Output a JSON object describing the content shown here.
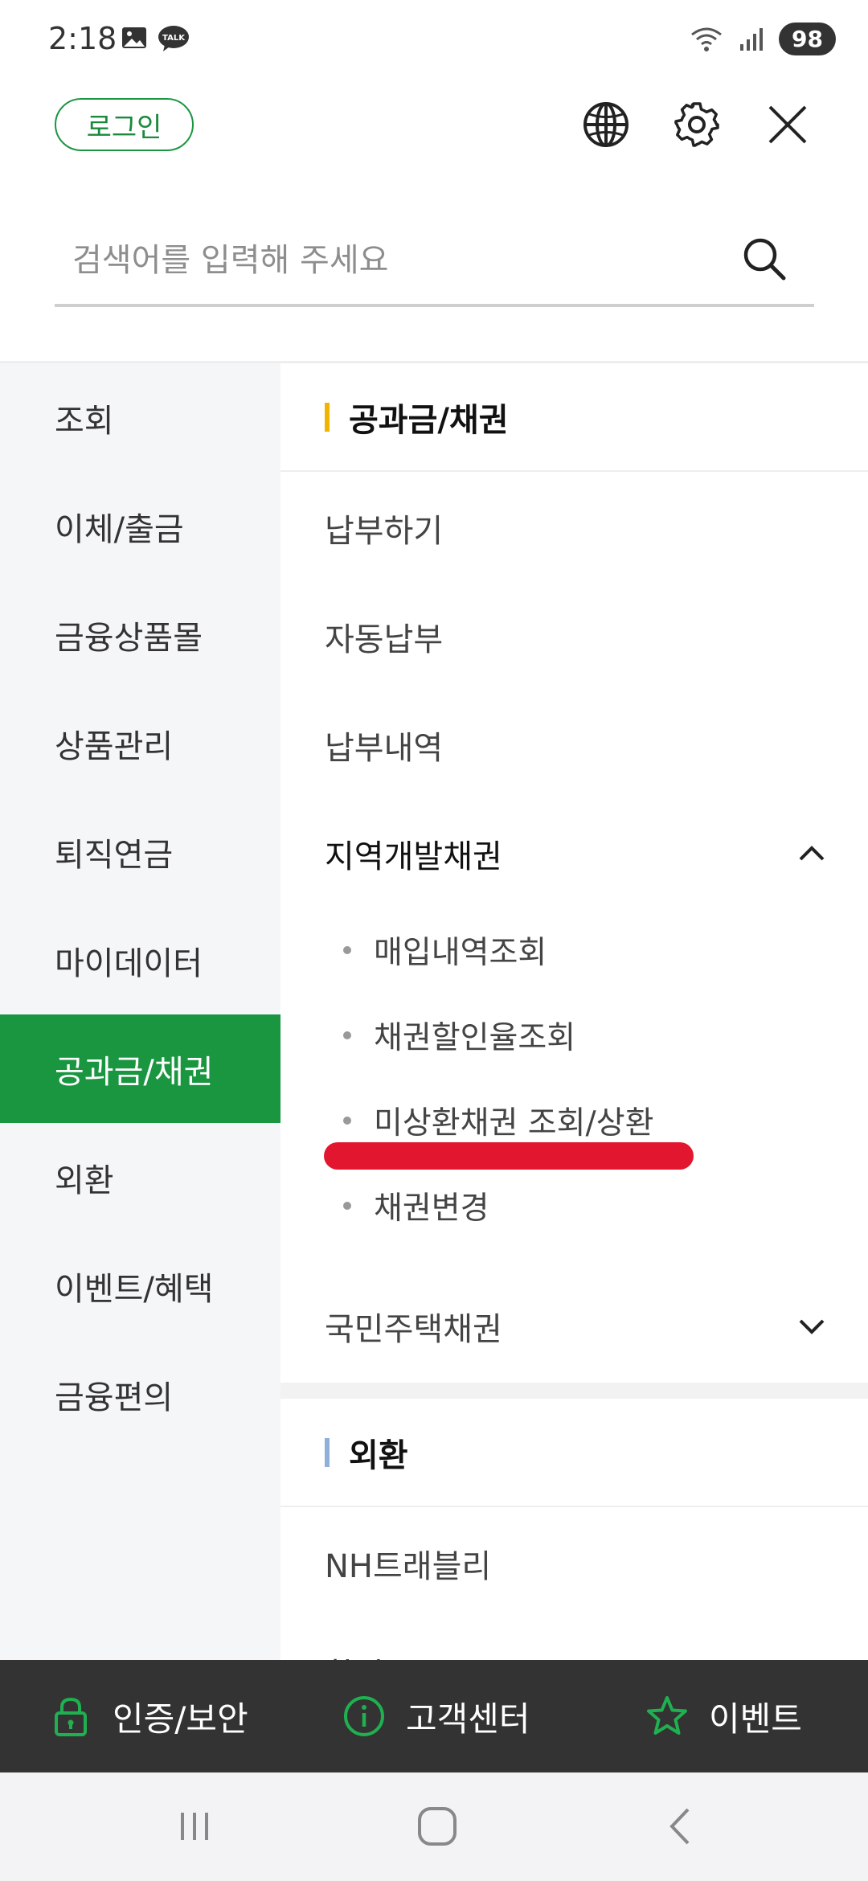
{
  "status_bar": {
    "time": "2:18",
    "talk_badge": "TALK",
    "battery": "98"
  },
  "header": {
    "login_label": "로그인"
  },
  "search": {
    "placeholder": "검색어를 입력해 주세요"
  },
  "left_nav": {
    "items": [
      {
        "label": "조회"
      },
      {
        "label": "이체/출금"
      },
      {
        "label": "금융상품몰"
      },
      {
        "label": "상품관리"
      },
      {
        "label": "퇴직연금"
      },
      {
        "label": "마이데이터"
      },
      {
        "label": "공과금/채권"
      },
      {
        "label": "외환"
      },
      {
        "label": "이벤트/혜택"
      },
      {
        "label": "금융편의"
      }
    ],
    "active_index": 6
  },
  "content": {
    "section1": {
      "title": "공과금/채권",
      "bar_color": "#f0b400",
      "items": [
        {
          "label": "납부하기"
        },
        {
          "label": "자동납부"
        },
        {
          "label": "납부내역"
        }
      ],
      "expanded_group": {
        "label": "지역개발채권",
        "sub_items": [
          {
            "label": "매입내역조회"
          },
          {
            "label": "채권할인율조회"
          },
          {
            "label": "미상환채권 조회/상환"
          },
          {
            "label": "채권변경"
          }
        ]
      },
      "collapsed_group": {
        "label": "국민주택채권"
      }
    },
    "section2": {
      "title": "외환",
      "bar_color": "#8fb0d8",
      "items": [
        {
          "label": "NH트래블리"
        },
        {
          "label": "환전"
        }
      ]
    }
  },
  "bottom_bar": {
    "items": [
      {
        "label": "인증/보안",
        "icon": "lock-icon"
      },
      {
        "label": "고객센터",
        "icon": "info-icon"
      },
      {
        "label": "이벤트",
        "icon": "star-icon"
      }
    ]
  },
  "colors": {
    "brand_green": "#1a9641",
    "annotation_red": "#e2172f",
    "bottom_bar_bg": "#333333"
  }
}
